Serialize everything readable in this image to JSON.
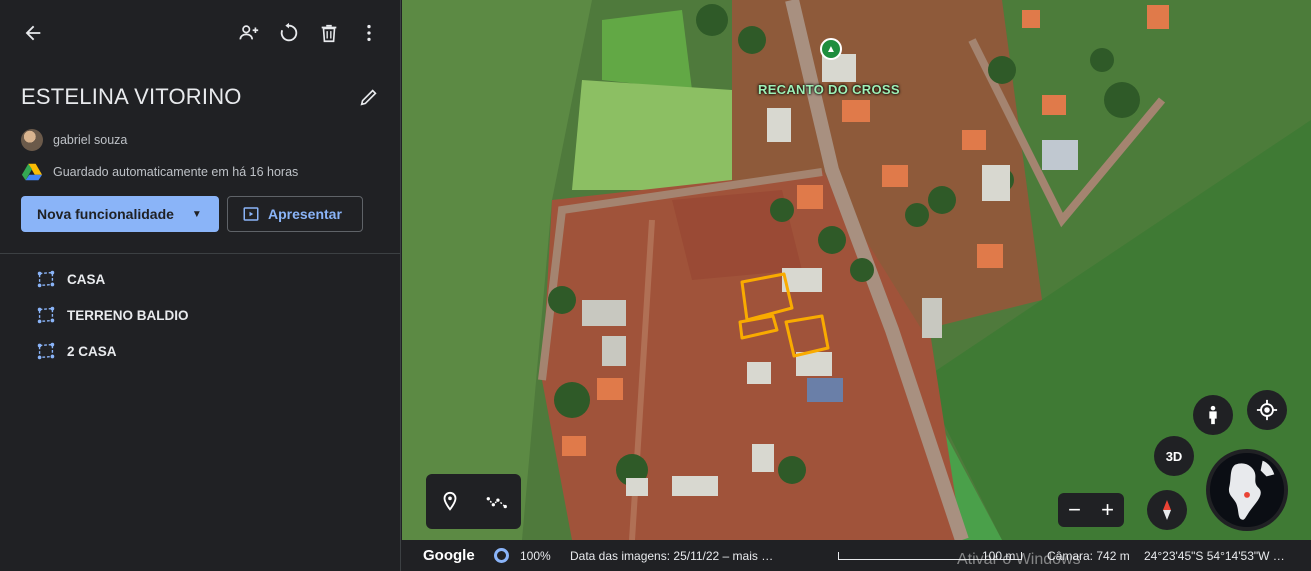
{
  "panel": {
    "title": "ESTELINA VITORINO",
    "owner": "gabriel souza",
    "save_status": "Guardado automaticamente em há 16 horas",
    "primary_button": "Nova funcionalidade",
    "present_button": "Apresentar",
    "layers": [
      {
        "label": "CASA"
      },
      {
        "label": "TERRENO BALDIO"
      },
      {
        "label": "2 CASA"
      }
    ]
  },
  "map": {
    "place_label": "RECANTO DO CROSS",
    "view_3d_label": "3D",
    "zoom_in": "+",
    "zoom_out": "−"
  },
  "status": {
    "brand": "Google",
    "render_percent": "100%",
    "imagery_date": "Data das imagens: 25/11/22 – mais …",
    "scale": "100 m",
    "camera": "Câmara: 742 m",
    "coordinates": "24°23'45\"S 54°14'53\"W …"
  },
  "watermark": "Ativar o Windows",
  "colors": {
    "accent": "#8ab4f8",
    "panel_bg": "#202124",
    "outline": "#f9ab00"
  }
}
